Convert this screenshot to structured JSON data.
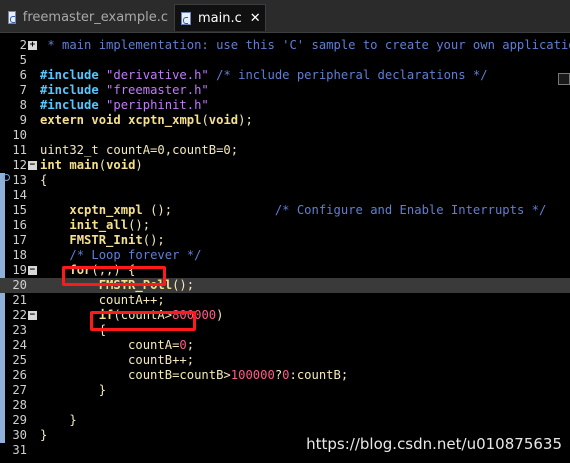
{
  "tabs": [
    {
      "label": "freemaster_example.c",
      "active": false
    },
    {
      "label": "main.c",
      "active": true
    }
  ],
  "lines": [
    {
      "num": "2",
      "fold": "+",
      "tokens": [
        {
          "t": " * main implementation: use this 'C' sample to create your own application",
          "c": "collapsed"
        }
      ]
    },
    {
      "num": "5",
      "tokens": []
    },
    {
      "num": "6",
      "tokens": [
        {
          "t": "#include ",
          "c": "preproc"
        },
        {
          "t": "\"derivative.h\"",
          "c": "string"
        },
        {
          "t": " /* include peripheral declarations */",
          "c": "comment"
        }
      ]
    },
    {
      "num": "7",
      "tokens": [
        {
          "t": "#include ",
          "c": "preproc"
        },
        {
          "t": "\"freemaster.h\"",
          "c": "string"
        }
      ]
    },
    {
      "num": "8",
      "tokens": [
        {
          "t": "#include ",
          "c": "preproc"
        },
        {
          "t": "\"periphinit.h\"",
          "c": "string"
        }
      ]
    },
    {
      "num": "9",
      "tokens": [
        {
          "t": "extern",
          "c": "kw"
        },
        {
          "t": " ",
          "c": "plain"
        },
        {
          "t": "void",
          "c": "kw"
        },
        {
          "t": " ",
          "c": "plain"
        },
        {
          "t": "xcptn_xmpl",
          "c": "fn"
        },
        {
          "t": "(",
          "c": "plain"
        },
        {
          "t": "void",
          "c": "kw"
        },
        {
          "t": ");",
          "c": "plain"
        }
      ]
    },
    {
      "num": "10",
      "tokens": []
    },
    {
      "num": "11",
      "tokens": [
        {
          "t": "uint32_t countA=0,countB=0;",
          "c": "plain"
        }
      ]
    },
    {
      "num": "12",
      "fold": "-",
      "tokens": [
        {
          "t": "int",
          "c": "kw"
        },
        {
          "t": " ",
          "c": "plain"
        },
        {
          "t": "main",
          "c": "fn"
        },
        {
          "t": "(",
          "c": "plain"
        },
        {
          "t": "void",
          "c": "kw"
        },
        {
          "t": ")",
          "c": "plain"
        }
      ]
    },
    {
      "num": "13",
      "tokens": [
        {
          "t": "{",
          "c": "plain"
        }
      ]
    },
    {
      "num": "14",
      "tokens": []
    },
    {
      "num": "15",
      "tokens": [
        {
          "t": "    ",
          "c": "plain"
        },
        {
          "t": "xcptn_xmpl",
          "c": "fn"
        },
        {
          "t": " ();",
          "c": "plain"
        },
        {
          "t": "              /* Configure and Enable Interrupts */",
          "c": "comment"
        }
      ]
    },
    {
      "num": "16",
      "tokens": [
        {
          "t": "    ",
          "c": "plain"
        },
        {
          "t": "init_all",
          "c": "fn"
        },
        {
          "t": "();",
          "c": "plain"
        }
      ]
    },
    {
      "num": "17",
      "tokens": [
        {
          "t": "    ",
          "c": "plain"
        },
        {
          "t": "FMSTR_Init",
          "c": "fn"
        },
        {
          "t": "();",
          "c": "plain"
        }
      ]
    },
    {
      "num": "18",
      "tokens": [
        {
          "t": "    ",
          "c": "plain"
        },
        {
          "t": "/* Loop forever */",
          "c": "comment"
        }
      ]
    },
    {
      "num": "19",
      "fold": "-",
      "tokens": [
        {
          "t": "    ",
          "c": "plain"
        },
        {
          "t": "for",
          "c": "kw"
        },
        {
          "t": "(;;) {",
          "c": "plain"
        }
      ]
    },
    {
      "num": "20",
      "current": true,
      "tokens": [
        {
          "t": "        ",
          "c": "plain"
        },
        {
          "t": "FMSTR_Poll",
          "c": "fn"
        },
        {
          "t": "();",
          "c": "plain"
        }
      ]
    },
    {
      "num": "21",
      "tokens": [
        {
          "t": "        countA++;",
          "c": "plain"
        }
      ]
    },
    {
      "num": "22",
      "fold": "-",
      "tokens": [
        {
          "t": "        ",
          "c": "plain"
        },
        {
          "t": "if",
          "c": "kw"
        },
        {
          "t": "(countA>",
          "c": "plain"
        },
        {
          "t": "800000",
          "c": "number"
        },
        {
          "t": ")",
          "c": "plain"
        }
      ]
    },
    {
      "num": "23",
      "tokens": [
        {
          "t": "        {",
          "c": "plain"
        }
      ]
    },
    {
      "num": "24",
      "tokens": [
        {
          "t": "            countA=",
          "c": "plain"
        },
        {
          "t": "0",
          "c": "number"
        },
        {
          "t": ";",
          "c": "plain"
        }
      ]
    },
    {
      "num": "25",
      "tokens": [
        {
          "t": "            countB++;",
          "c": "plain"
        }
      ]
    },
    {
      "num": "26",
      "tokens": [
        {
          "t": "            countB=countB>",
          "c": "plain"
        },
        {
          "t": "100000",
          "c": "number"
        },
        {
          "t": "?",
          "c": "plain"
        },
        {
          "t": "0",
          "c": "number"
        },
        {
          "t": ":countB;",
          "c": "plain"
        }
      ]
    },
    {
      "num": "27",
      "tokens": [
        {
          "t": "        }",
          "c": "plain"
        }
      ]
    },
    {
      "num": "28",
      "tokens": []
    },
    {
      "num": "29",
      "tokens": [
        {
          "t": "    }",
          "c": "plain"
        }
      ]
    },
    {
      "num": "30",
      "tokens": [
        {
          "t": "}",
          "c": "plain"
        }
      ]
    },
    {
      "num": "31",
      "tokens": []
    }
  ],
  "watermark": "https://blog.csdn.net/u010875635",
  "colors": {
    "background": "#000000",
    "highlight_box": "#ff1a1a",
    "current_line": "#3a3a3a"
  }
}
